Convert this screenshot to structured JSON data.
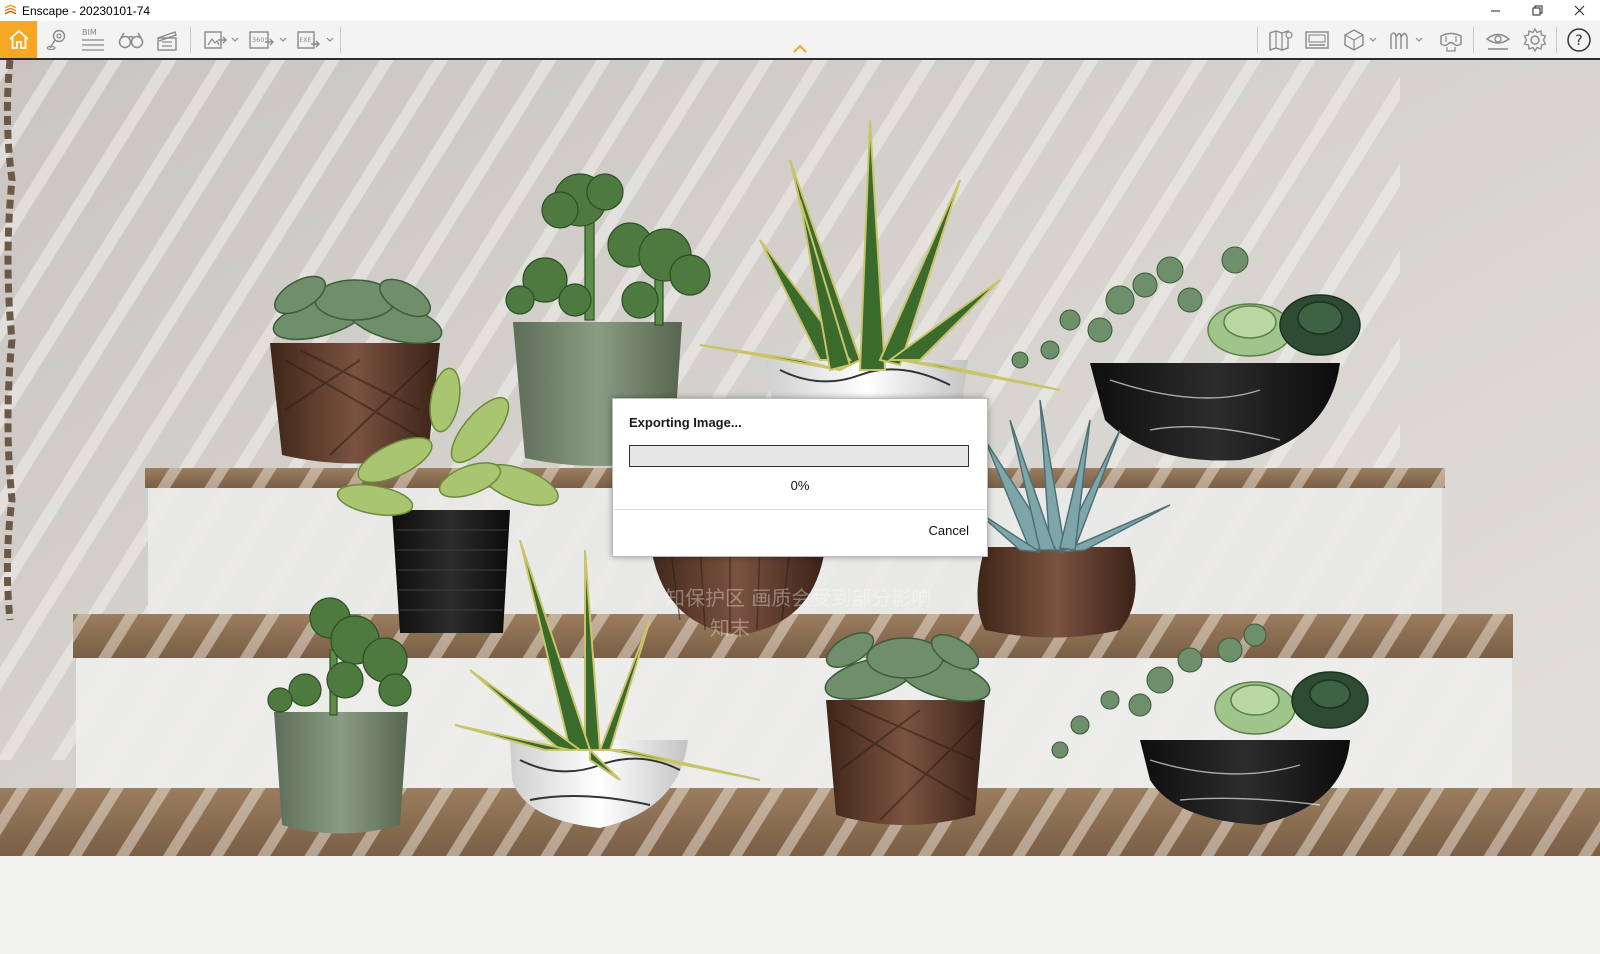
{
  "window": {
    "title": "Enscape - 20230101-74",
    "controls": [
      {
        "name": "minimize-icon"
      },
      {
        "name": "restore-icon"
      },
      {
        "name": "close-icon"
      }
    ]
  },
  "toolbar": {
    "left_icons": [
      {
        "name": "home-icon",
        "active": true
      },
      {
        "name": "map-pin-icon"
      },
      {
        "name": "bim-icon",
        "label": "BIM"
      },
      {
        "name": "binoculars-icon"
      },
      {
        "name": "clapperboard-icon"
      },
      {
        "name": "export-image-icon"
      },
      {
        "name": "export-panorama-icon",
        "label": "360°"
      },
      {
        "name": "export-exe-icon",
        "label": "EXE"
      }
    ],
    "right_icons": [
      {
        "name": "map-view-icon"
      },
      {
        "name": "video-editor-icon"
      },
      {
        "name": "asset-library-icon"
      },
      {
        "name": "material-editor-icon"
      },
      {
        "name": "vr-headset-icon"
      },
      {
        "name": "visual-settings-eye-icon"
      },
      {
        "name": "settings-gear-icon"
      },
      {
        "name": "help-icon",
        "label": "?"
      }
    ],
    "accent_color": "#f5a623"
  },
  "dialog": {
    "title": "Exporting Image...",
    "progress_fraction": 0,
    "progress_label": "0%",
    "cancel_label": "Cancel"
  },
  "watermark": {
    "line1": "知保护区  画质会受到部分影响",
    "line2": "知末"
  }
}
